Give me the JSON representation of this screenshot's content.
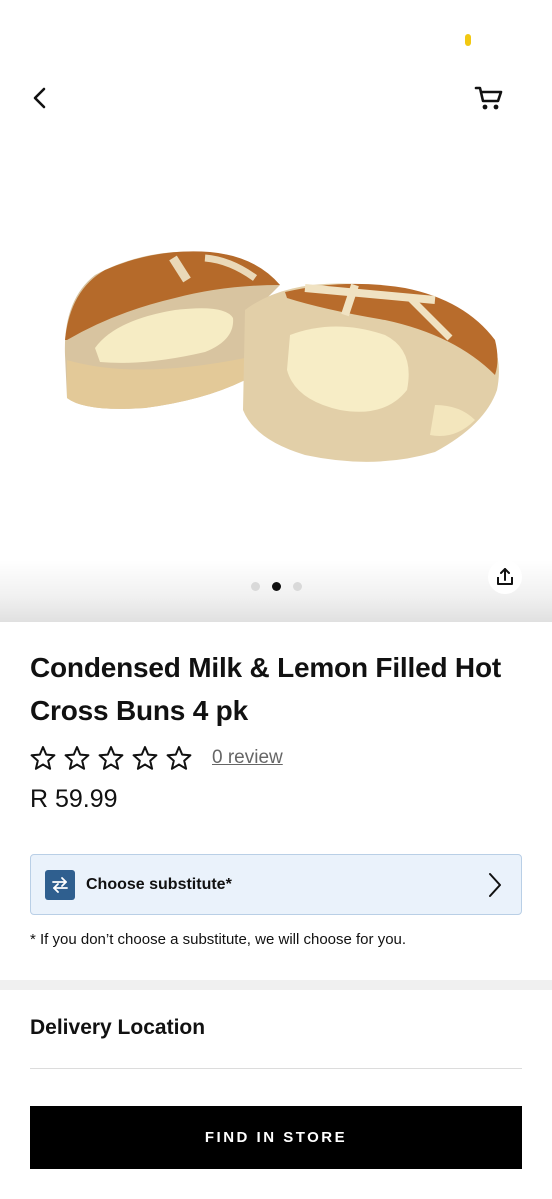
{
  "header": {
    "back_icon": "chevron-left-icon",
    "cart_icon": "cart-icon",
    "status_indicator_color": "#f2c811"
  },
  "gallery": {
    "image_subject": "hot cross buns cut in half with condensed milk and lemon filling",
    "slide_count": 3,
    "active_slide": 2,
    "share_icon": "share-icon"
  },
  "product": {
    "title": "Condensed Milk & Lemon Filled Hot Cross Buns 4 pk",
    "rating_stars": 0,
    "rating_max": 5,
    "reviews_label": "0 review",
    "price": "R 59.99"
  },
  "substitute": {
    "label": "Choose substitute*",
    "icon": "swap-arrows-icon",
    "note": "* If you don’t choose a substitute, we will choose for you."
  },
  "delivery": {
    "title": "Delivery Location"
  },
  "actions": {
    "find_in_store": "FIND IN STORE"
  },
  "colors": {
    "primary_button": "#000000",
    "substitute_bg": "#eaf2fb",
    "substitute_icon_bg": "#2f5f8f"
  }
}
